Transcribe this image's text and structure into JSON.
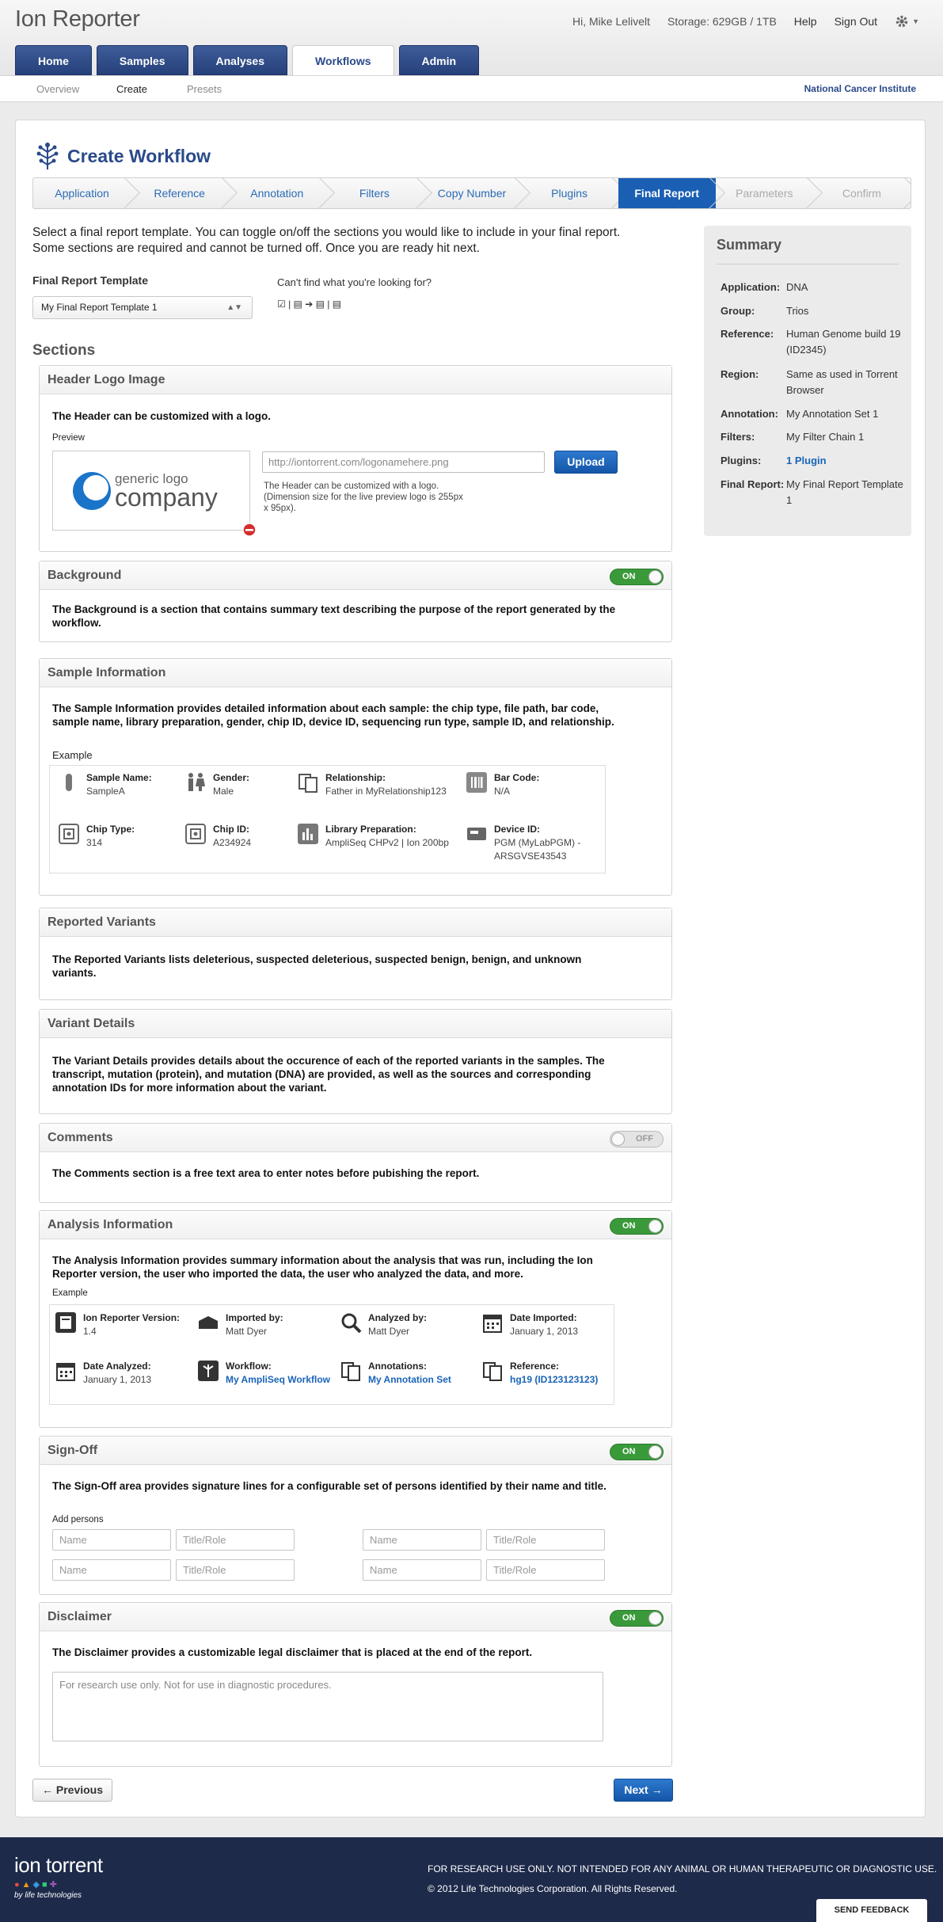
{
  "app": {
    "title": "Ion Reporter"
  },
  "user": {
    "greeting": "Hi, Mike Lelivelt",
    "storage": "Storage: 629GB / 1TB",
    "help": "Help",
    "signout": "Sign Out"
  },
  "nav": {
    "tabs": [
      "Home",
      "Samples",
      "Analyses",
      "Workflows",
      "Admin"
    ]
  },
  "subnav": {
    "items": [
      "Overview",
      "Create",
      "Presets"
    ],
    "institution": "National Cancer Institute"
  },
  "page": {
    "title": "Create Workflow"
  },
  "wizard": {
    "steps": [
      "Application",
      "Reference",
      "Annotation",
      "Filters",
      "Copy Number",
      "Plugins",
      "Final Report",
      "Parameters",
      "Confirm"
    ]
  },
  "intro": {
    "text": "Select a final report template. You can toggle on/off the sections you would like to include in your final report. Some sections are required and cannot be turned off. Once you are ready hit next."
  },
  "template": {
    "label": "Final Report Template",
    "selected": "My Final Report Template 1",
    "cant_find": "Can't find what you're looking for?",
    "tools": "☑ | ▤ ➔ ▤ | ▤"
  },
  "sections_heading": "Sections",
  "header_logo": {
    "title": "Header Logo Image",
    "desc": "The Header can be customized with a logo.",
    "preview_label": "Preview",
    "logo_small": "generic logo",
    "logo_big": "company",
    "input_placeholder": "http://iontorrent.com/logonamehere.png",
    "upload": "Upload",
    "note": "The Header can be customized with a logo. (Dimension size for the live preview logo is 255px x 95px)."
  },
  "background": {
    "title": "Background",
    "toggle": "ON",
    "desc": "The Background is a section that contains summary text describing the purpose of the report generated by the workflow."
  },
  "sample_info": {
    "title": "Sample Information",
    "desc": "The Sample Information provides detailed information about each sample: the chip type, file path, bar code, sample name, library preparation, gender, chip ID, device ID, sequencing run type, sample ID, and relationship.",
    "example_label": "Example",
    "fields": [
      {
        "label": "Sample Name:",
        "value": "SampleA",
        "icon": "tube-icon"
      },
      {
        "label": "Gender:",
        "value": "Male",
        "icon": "gender-icon"
      },
      {
        "label": "Relationship:",
        "value": "Father in MyRelationship123",
        "icon": "relationship-icon"
      },
      {
        "label": "Bar Code:",
        "value": "N/A",
        "icon": "barcode-icon"
      },
      {
        "label": "Chip Type:",
        "value": "314",
        "icon": "chip-icon"
      },
      {
        "label": "Chip ID:",
        "value": "A234924",
        "icon": "chip-icon"
      },
      {
        "label": "Library Preparation:",
        "value": "AmpliSeq CHPv2 | Ion 200bp",
        "icon": "library-icon"
      },
      {
        "label": "Device ID:",
        "value": "PGM (MyLabPGM) - ARSGVSE43543",
        "icon": "device-icon"
      }
    ]
  },
  "reported_variants": {
    "title": "Reported Variants",
    "desc": "The Reported Variants lists deleterious, suspected deleterious, suspected benign, benign, and unknown variants."
  },
  "variant_details": {
    "title": "Variant Details",
    "desc": "The Variant Details provides details about the occurence of each of the reported variants in the samples. The transcript, mutation (protein), and mutation (DNA) are provided, as well as the sources and corresponding annotation IDs for more information about the variant."
  },
  "comments": {
    "title": "Comments",
    "toggle": "OFF",
    "desc": "The Comments section is a free text area to enter notes before pubishing the report."
  },
  "analysis_info": {
    "title": "Analysis Information",
    "toggle": "ON",
    "desc": "The Analysis Information provides summary information about the analysis that was run, including the Ion Reporter version, the user who imported the data, the user who analyzed the data, and more.",
    "example_label": "Example",
    "fields": [
      {
        "label": "Ion Reporter Version:",
        "value": "1.4",
        "icon": "version-icon"
      },
      {
        "label": "Imported by:",
        "value": "Matt Dyer",
        "icon": "import-icon"
      },
      {
        "label": "Analyzed by:",
        "value": "Matt Dyer",
        "icon": "analyze-icon"
      },
      {
        "label": "Date Imported:",
        "value": "January 1, 2013",
        "icon": "calendar-icon"
      },
      {
        "label": "Date Analyzed:",
        "value": "January 1, 2013",
        "icon": "calendar-icon"
      },
      {
        "label": "Workflow:",
        "value": "My AmpliSeq Workflow",
        "icon": "workflow-icon"
      },
      {
        "label": "Annotations:",
        "value": "My Annotation Set",
        "icon": "annotation-icon"
      },
      {
        "label": "Reference:",
        "value": "hg19 (ID123123123)",
        "icon": "reference-icon"
      }
    ]
  },
  "signoff": {
    "title": "Sign-Off",
    "toggle": "ON",
    "desc": "The Sign-Off area provides signature lines for a configurable set of persons identified by their name and title.",
    "add_label": "Add persons",
    "name_ph": "Name",
    "role_ph": "Title/Role"
  },
  "disclaimer": {
    "title": "Disclaimer",
    "toggle": "ON",
    "desc": "The Disclaimer provides a customizable legal disclaimer that is placed at the end of the report.",
    "text": "For research use only. Not for use in diagnostic procedures."
  },
  "buttons": {
    "previous": "← Previous",
    "next": "Next →"
  },
  "summary": {
    "title": "Summary",
    "rows": [
      {
        "k": "Application:",
        "v": "DNA"
      },
      {
        "k": "Group:",
        "v": "Trios"
      },
      {
        "k": "Reference:",
        "v": "Human Genome build 19 (ID2345)"
      },
      {
        "k": "Region:",
        "v": "Same as used in Torrent Browser"
      },
      {
        "k": "Annotation:",
        "v": "My Annotation Set 1"
      },
      {
        "k": "Filters:",
        "v": "My Filter Chain 1"
      },
      {
        "k": "Plugins:",
        "v": "1 Plugin"
      },
      {
        "k": "Final Report:",
        "v": "My Final Report Template 1"
      }
    ]
  },
  "footer": {
    "brand": "ion torrent",
    "brand_sub": "by life technologies",
    "line1": "FOR RESEARCH USE ONLY. NOT INTENDED FOR ANY ANIMAL OR HUMAN THERAPEUTIC OR DIAGNOSTIC USE.",
    "line2": "© 2012 Life Technologies Corporation. All Rights Reserved.",
    "feedback": "SEND FEEDBACK"
  },
  "colors": {
    "brand_blue": "#2a4a8a",
    "nav_blue": "#26407a",
    "accent_blue": "#1a5fb4",
    "toggle_on": "#3a9a3a",
    "footer": "#1e2a4a"
  }
}
